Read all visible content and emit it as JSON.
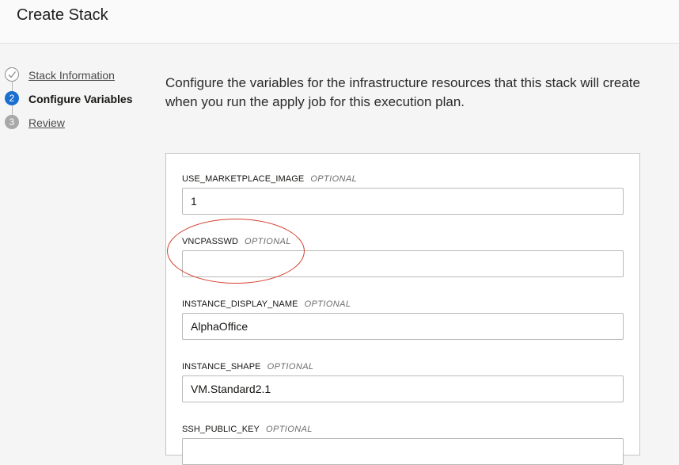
{
  "header": {
    "title": "Create Stack"
  },
  "steps": [
    {
      "number": "",
      "label": "Stack Information",
      "state": "done"
    },
    {
      "number": "2",
      "label": "Configure Variables",
      "state": "current"
    },
    {
      "number": "3",
      "label": "Review",
      "state": "future"
    }
  ],
  "intro": "Configure the variables for the infrastructure resources that this stack will create when you run the apply job for this execution plan.",
  "fields": [
    {
      "name": "USE_MARKETPLACE_IMAGE",
      "optional": "OPTIONAL",
      "value": "1"
    },
    {
      "name": "VNCPASSWD",
      "optional": "OPTIONAL",
      "value": ""
    },
    {
      "name": "INSTANCE_DISPLAY_NAME",
      "optional": "OPTIONAL",
      "value": "AlphaOffice"
    },
    {
      "name": "INSTANCE_SHAPE",
      "optional": "OPTIONAL",
      "value": "VM.Standard2.1"
    },
    {
      "name": "SSH_PUBLIC_KEY",
      "optional": "OPTIONAL",
      "value": ""
    }
  ],
  "colors": {
    "accent": "#1a6ecf",
    "annotation": "#d3402f"
  }
}
